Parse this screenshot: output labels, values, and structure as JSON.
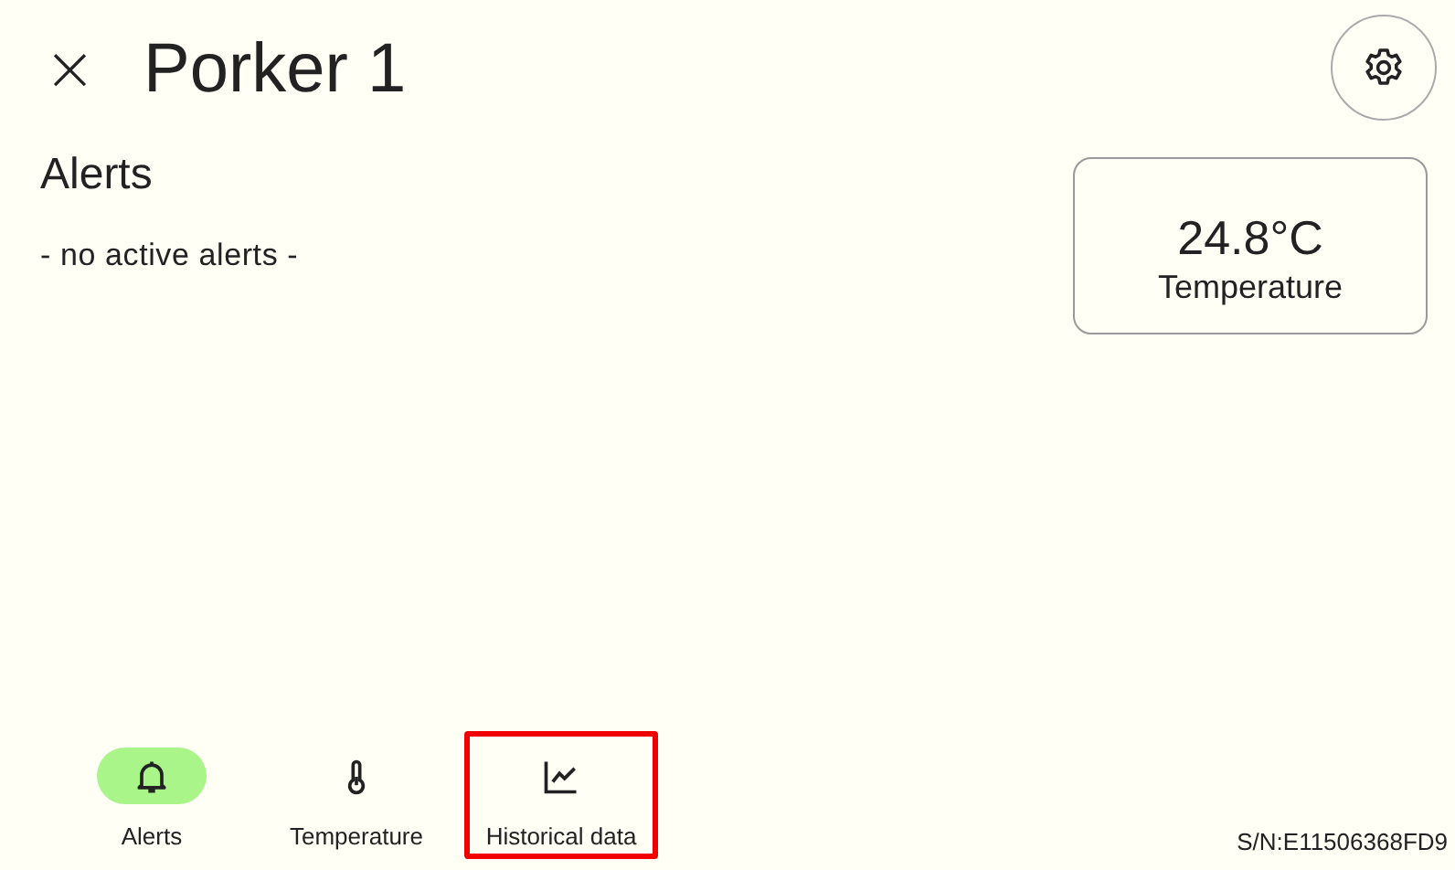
{
  "header": {
    "close": "×",
    "title": "Porker 1"
  },
  "alerts": {
    "heading": "Alerts",
    "empty_text": "- no active alerts -"
  },
  "sensor_card": {
    "value": "24.8°C",
    "label": "Temperature"
  },
  "nav": [
    {
      "kind": "bell",
      "label": "Alerts",
      "selected": true,
      "highlighted": false
    },
    {
      "kind": "thermometer",
      "label": "Temperature",
      "selected": false,
      "highlighted": false
    },
    {
      "kind": "chart",
      "label": "Historical data",
      "selected": false,
      "highlighted": true
    }
  ],
  "serial": "S/N:E11506368FD9"
}
